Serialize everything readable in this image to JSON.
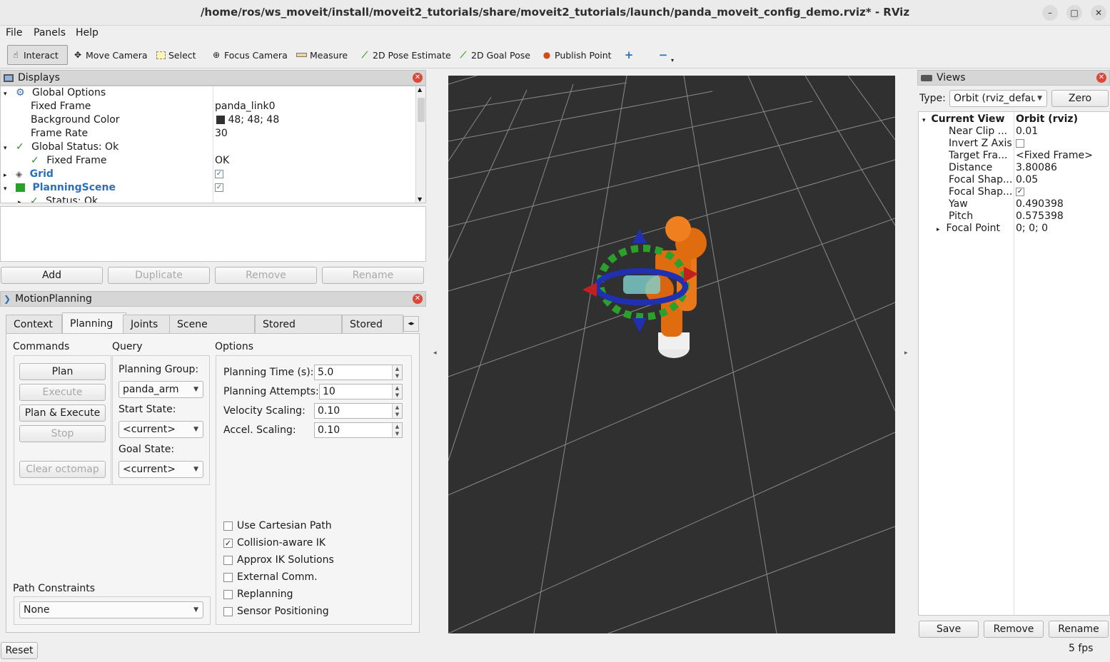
{
  "window": {
    "title": "/home/ros/ws_moveit/install/moveit2_tutorials/share/moveit2_tutorials/launch/panda_moveit_config_demo.rviz* - RViz",
    "controls": [
      "–",
      "□",
      "✕"
    ]
  },
  "menu": [
    "File",
    "Panels",
    "Help"
  ],
  "toolbar": {
    "tools": [
      {
        "label": "Interact",
        "icon": "hand-pointer-icon"
      },
      {
        "label": "Move Camera",
        "icon": "move-camera-icon"
      },
      {
        "label": "Select",
        "icon": "select-icon"
      },
      {
        "label": "Focus Camera",
        "icon": "focus-camera-icon"
      },
      {
        "label": "Measure",
        "icon": "measure-icon"
      },
      {
        "label": "2D Pose Estimate",
        "icon": "pose-estimate-icon"
      },
      {
        "label": "2D Goal Pose",
        "icon": "goal-pose-icon"
      },
      {
        "label": "Publish Point",
        "icon": "map-pin-icon"
      }
    ]
  },
  "displays": {
    "title": "Displays",
    "rows": [
      {
        "name": "Global Options",
        "value": ""
      },
      {
        "name": "Fixed Frame",
        "value": "panda_link0"
      },
      {
        "name": "Background Color",
        "value": "48; 48; 48"
      },
      {
        "name": "Frame Rate",
        "value": "30"
      },
      {
        "name": "Global Status: Ok",
        "value": ""
      },
      {
        "name": "Fixed Frame",
        "value": "OK"
      },
      {
        "name": "Grid",
        "value": ""
      },
      {
        "name": "PlanningScene",
        "value": ""
      },
      {
        "name": "Status: Ok",
        "value": ""
      }
    ],
    "buttons": {
      "add": "Add",
      "duplicate": "Duplicate",
      "remove": "Remove",
      "rename": "Rename"
    }
  },
  "motion_planning": {
    "title": "MotionPlanning",
    "tabs": [
      "Context",
      "Planning",
      "Joints",
      "Scene Objects",
      "Stored Scenes",
      "Stored Sta"
    ],
    "commands": {
      "heading": "Commands",
      "plan": "Plan",
      "execute": "Execute",
      "plan_execute": "Plan & Execute",
      "stop": "Stop",
      "clear_octomap": "Clear octomap"
    },
    "query": {
      "heading": "Query",
      "planning_group_label": "Planning Group:",
      "planning_group": "panda_arm",
      "start_state_label": "Start State:",
      "start_state": "<current>",
      "goal_state_label": "Goal State:",
      "goal_state": "<current>"
    },
    "options": {
      "heading": "Options",
      "planning_time_label": "Planning Time (s):",
      "planning_time": "5.0",
      "planning_attempts_label": "Planning Attempts:",
      "planning_attempts": "10",
      "velocity_scaling_label": "Velocity Scaling:",
      "velocity_scaling": "0.10",
      "accel_scaling_label": "Accel. Scaling:",
      "accel_scaling": "0.10",
      "checkboxes": [
        {
          "label": "Use Cartesian Path",
          "checked": false
        },
        {
          "label": "Collision-aware IK",
          "checked": true
        },
        {
          "label": "Approx IK Solutions",
          "checked": false
        },
        {
          "label": "External Comm.",
          "checked": false
        },
        {
          "label": "Replanning",
          "checked": false
        },
        {
          "label": "Sensor Positioning",
          "checked": false
        }
      ]
    },
    "path_constraints_label": "Path Constraints",
    "path_constraints": "None"
  },
  "views": {
    "title": "Views",
    "type_label": "Type:",
    "type_value": "Orbit (rviz_defau",
    "zero": "Zero",
    "current_view": {
      "name": "Current View",
      "value": "Orbit (rviz)"
    },
    "props": [
      {
        "name": "Near Clip ...",
        "value": "0.01"
      },
      {
        "name": "Invert Z Axis",
        "value": ""
      },
      {
        "name": "Target Fra...",
        "value": "<Fixed Frame>"
      },
      {
        "name": "Distance",
        "value": "3.80086"
      },
      {
        "name": "Focal Shap...",
        "value": "0.05"
      },
      {
        "name": "Focal Shap...",
        "value": ""
      },
      {
        "name": "Yaw",
        "value": "0.490398"
      },
      {
        "name": "Pitch",
        "value": "0.575398"
      },
      {
        "name": "Focal Point",
        "value": "0; 0; 0"
      }
    ],
    "buttons": {
      "save": "Save",
      "remove": "Remove",
      "rename": "Rename"
    }
  },
  "statusbar": {
    "reset": "Reset",
    "fps": "5 fps"
  },
  "colors": {
    "background": "#303030",
    "grid": "#a0a0a0",
    "robot": "#e06c10",
    "link_blue": "#2a6fbd"
  }
}
